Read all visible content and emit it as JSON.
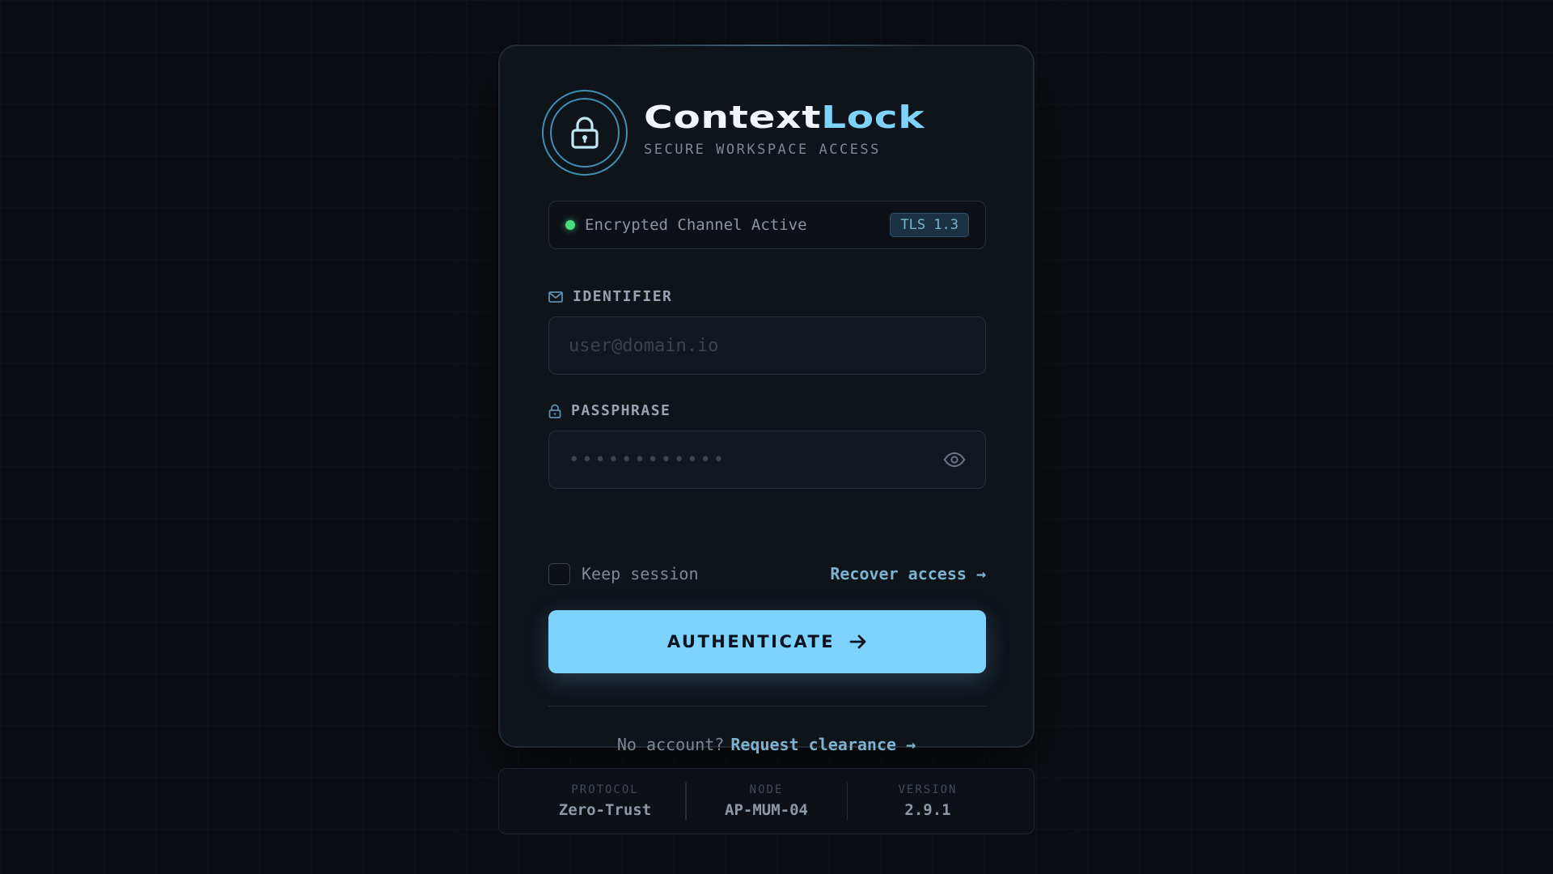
{
  "brand": {
    "title_main": "Context",
    "title_accent": "Lock",
    "subtitle": "SECURE WORKSPACE ACCESS",
    "logo_icon": "lock-icon"
  },
  "status": {
    "text": "Encrypted Channel Active",
    "badge": "TLS 1.3",
    "indicator_color": "#4ade80"
  },
  "identifier": {
    "label": "IDENTIFIER",
    "icon": "mail-icon",
    "placeholder": "user@domain.io",
    "value": ""
  },
  "passphrase": {
    "label": "PASSPHRASE",
    "icon": "lock-icon",
    "masked_value": "••••••••••••",
    "toggle_icon": "eye-icon"
  },
  "options": {
    "keep_session_label": "Keep session",
    "keep_session_checked": false,
    "recover_label": "Recover access →"
  },
  "auth_button": {
    "label": "AUTHENTICATE",
    "icon": "arrow-right-icon",
    "color": "#7dd3fc"
  },
  "signup": {
    "prompt": "No account?",
    "link_label": "Request clearance →"
  },
  "meta": [
    {
      "key": "PROTOCOL",
      "value": "Zero-Trust"
    },
    {
      "key": "NODE",
      "value": "AP-MUM-04"
    },
    {
      "key": "VERSION",
      "value": "2.9.1"
    }
  ],
  "colors": {
    "accent": "#7dd3fc",
    "background": "#0b0e13",
    "card": "#0f131a",
    "link": "#7cb4cf"
  }
}
